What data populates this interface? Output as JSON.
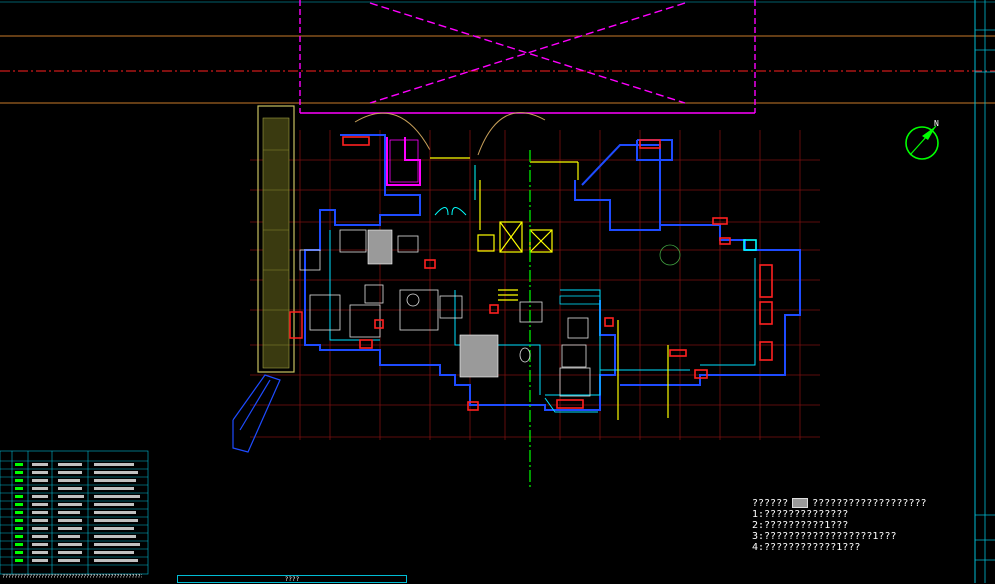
{
  "notes": {
    "line0_a": "??????",
    "line0_b": "???????????????????",
    "line1": "1:??????????????",
    "line2": "2:??????????1???",
    "line3": "3:??????????????????1???",
    "line4": "4:????????????1???"
  },
  "footer": {
    "note": "???????????????????????????????????????????????",
    "title": "????"
  },
  "colors": {
    "background": "#000000",
    "wall": "#1e4bff",
    "grid": "#8b1a1a",
    "magenta": "#ff00ff",
    "cyan": "#00ffff",
    "yellow": "#ffff00",
    "red": "#ff0000",
    "green": "#00ff00",
    "orange": "#c87a2a"
  }
}
